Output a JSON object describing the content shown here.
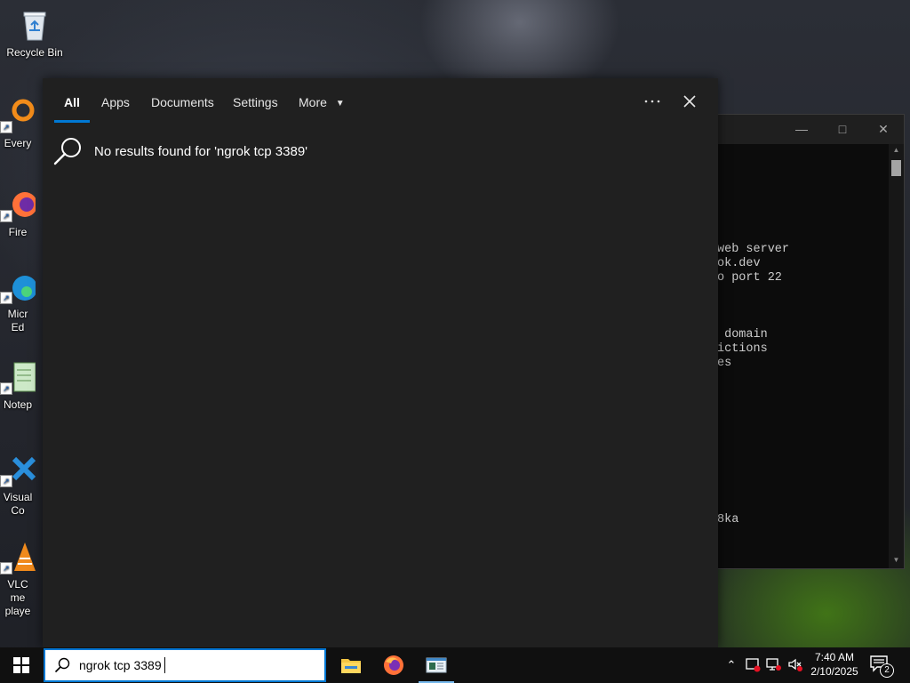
{
  "desktop": {
    "icons": [
      {
        "label": "Recycle Bin"
      },
      {
        "label": "Every"
      },
      {
        "label": "Fire"
      },
      {
        "label": "Micr Ed"
      },
      {
        "label": "Notep"
      },
      {
        "label": "Visual Co"
      },
      {
        "label": "VLC me playe"
      }
    ]
  },
  "terminal": {
    "lines": [
      "web server",
      "ok.dev",
      "o port 22",
      "",
      "",
      "",
      " domain",
      "ictions",
      "es",
      "",
      "",
      "",
      "",
      "",
      "",
      "",
      "",
      "",
      "",
      "8ka"
    ]
  },
  "search_panel": {
    "tabs": [
      {
        "label": "All"
      },
      {
        "label": "Apps"
      },
      {
        "label": "Documents"
      },
      {
        "label": "Settings"
      },
      {
        "label": "More"
      }
    ],
    "no_results_text": "No results found for 'ngrok tcp 3389'"
  },
  "taskbar": {
    "search_value": "ngrok tcp 3389",
    "clock_time": "7:40 AM",
    "clock_date": "2/10/2025",
    "notification_count": "2"
  },
  "icons": {
    "start": "windows-logo",
    "search": "magnifier",
    "close": "close-x",
    "more": "ellipsis",
    "explorer": "folder",
    "firefox": "firefox",
    "terminal": "terminal-window"
  },
  "colors": {
    "accent": "#0078d4",
    "panel_bg": "#202020",
    "taskbar_bg": "#101010"
  }
}
